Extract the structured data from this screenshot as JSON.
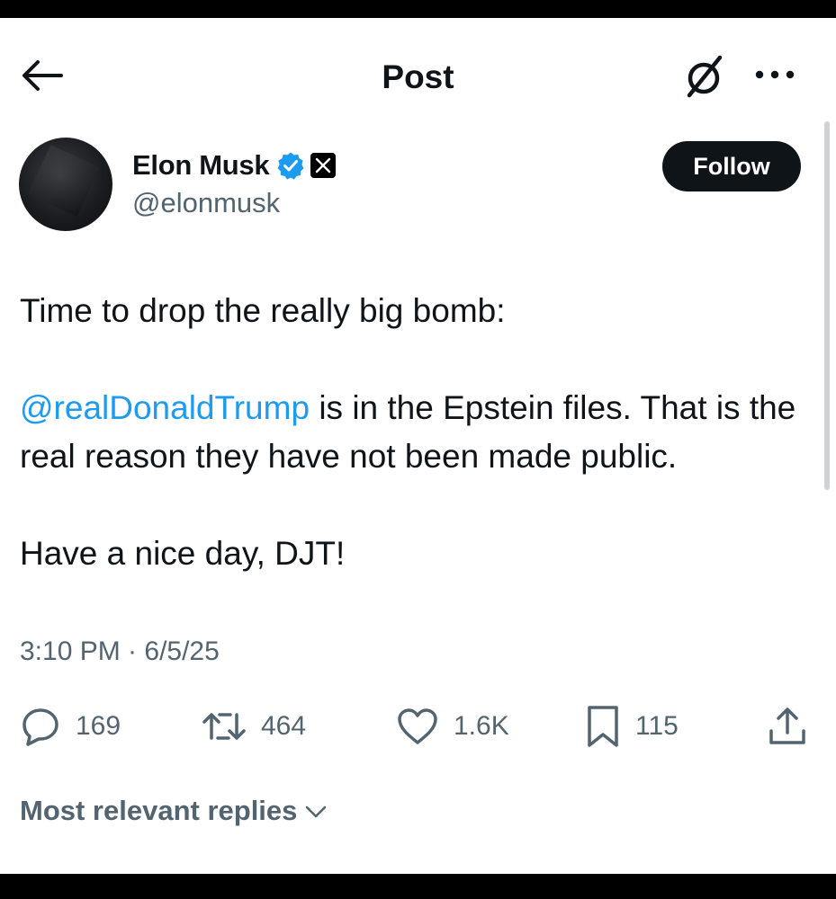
{
  "header": {
    "title": "Post",
    "back_icon": "arrow-left-icon",
    "grok_icon": "grok-icon",
    "more_icon": "more-dots-icon"
  },
  "author": {
    "display_name": "Elon Musk",
    "handle": "@elonmusk",
    "verified_icon": "verified-badge-icon",
    "affiliation_icon": "x-logo-icon",
    "follow_label": "Follow"
  },
  "tweet": {
    "line1": "Time to drop the really big bomb:",
    "mention": "@realDonaldTrump",
    "line2_rest": " is in the Epstein files. That is the real reason they have not been made public.",
    "line3": "Have a nice day, DJT!",
    "timestamp": "3:10 PM · 6/5/25"
  },
  "actions": {
    "replies": "169",
    "reposts": "464",
    "likes": "1.6K",
    "bookmarks": "115"
  },
  "replies_filter": {
    "label": "Most relevant replies"
  },
  "colors": {
    "accent": "#1d9bf0",
    "text": "#0f1419",
    "secondary": "#536471"
  }
}
